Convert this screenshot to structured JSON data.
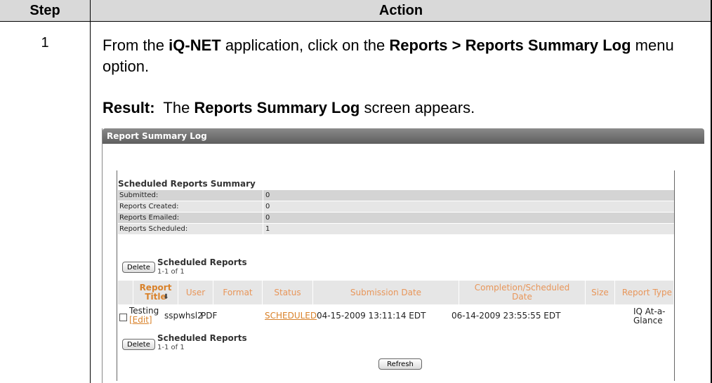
{
  "table": {
    "header_step": "Step",
    "header_action": "Action",
    "step_number": "1"
  },
  "instruction": {
    "pre": "From the ",
    "app": "iQ-NET",
    "mid": " application, click on the ",
    "menu": "Reports > Reports Summary Log",
    "post": " menu option."
  },
  "result": {
    "label": "Result:",
    "pre": "  The ",
    "screen": "Reports Summary Log",
    "post": " screen appears."
  },
  "screenshot": {
    "window_title": "Report Summary Log",
    "summary": {
      "title": "Scheduled Reports Summary",
      "rows": [
        {
          "label": "Submitted:",
          "value": "0"
        },
        {
          "label": "Reports Created:",
          "value": "0"
        },
        {
          "label": "Reports Emailed:",
          "value": "0"
        },
        {
          "label": "Reports Scheduled:",
          "value": "1"
        }
      ]
    },
    "delete_label": "Delete",
    "scheduled_heading": "Scheduled Reports",
    "scheduled_count": "1-1 of 1",
    "columns": {
      "title": "Report Title",
      "title_arrow": "⬇",
      "user": "User",
      "format": "Format",
      "status": "Status",
      "submission": "Submission Date",
      "completion": "Completion/Scheduled Date",
      "size": "Size",
      "type": "Report Type"
    },
    "row": {
      "title": "Testing",
      "edit": "[Edit]",
      "user": "sspwhsl2",
      "format": "PDF",
      "status": "SCHEDULED",
      "submission": "04-15-2009 13:11:14 EDT",
      "completion": "06-14-2009 23:55:55 EDT",
      "size": "",
      "type": "IQ At-a-Glance"
    },
    "refresh_label": "Refresh"
  }
}
